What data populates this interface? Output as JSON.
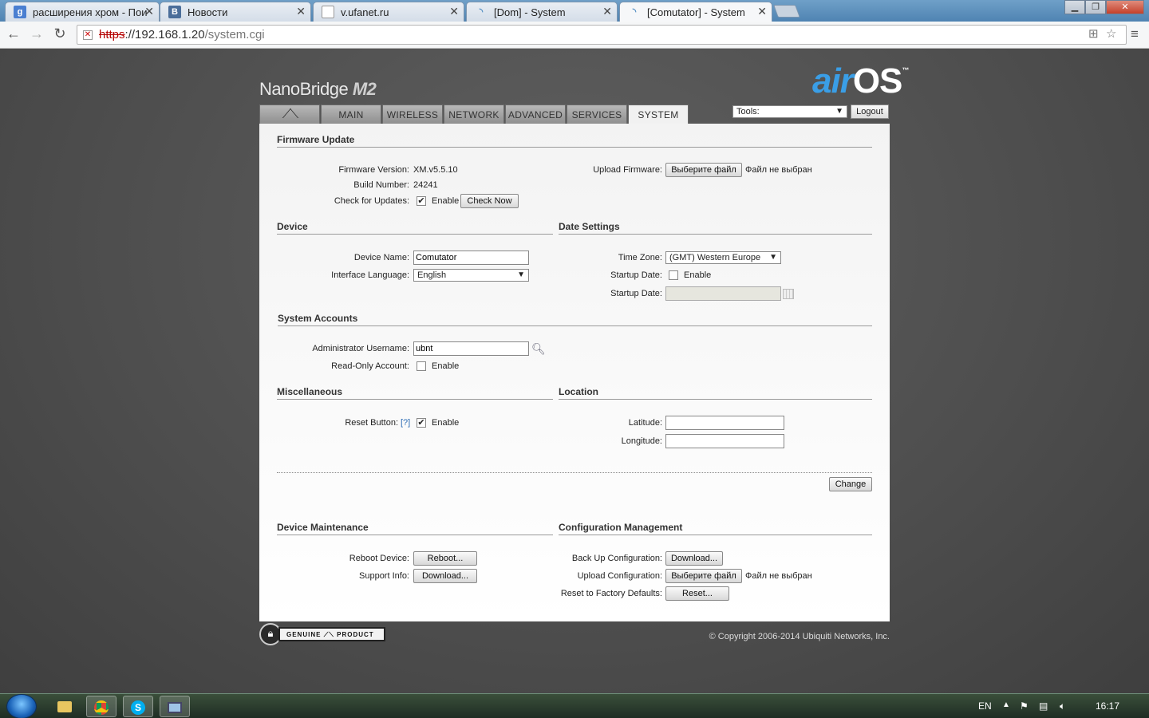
{
  "browser": {
    "tabs": [
      {
        "title": "расширения хром - Пои",
        "icon": "google-icon",
        "active": false
      },
      {
        "title": "Новости",
        "icon": "vk-icon",
        "active": false
      },
      {
        "title": "v.ufanet.ru",
        "icon": "page-icon",
        "active": false
      },
      {
        "title": "[Dom] - System",
        "icon": "wireless-icon",
        "active": false
      },
      {
        "title": "[Comutator] - System",
        "icon": "wireless-icon",
        "active": true
      }
    ],
    "address": {
      "scheme": "https",
      "host_rest": "://192.168.1.20",
      "path": "/system.cgi"
    },
    "window_buttons": {
      "minimize": "▁",
      "maximize": "❐",
      "close": "✕"
    },
    "nav": {
      "back": "←",
      "forward": "→",
      "reload": "↻",
      "menu": "≡",
      "star": "☆"
    }
  },
  "app": {
    "brand": "NanoBridge",
    "brand_model": "M2",
    "logo_air": "air",
    "logo_os": "OS",
    "logo_tm": "™",
    "nav_tabs": [
      "",
      "MAIN",
      "WIRELESS",
      "NETWORK",
      "ADVANCED",
      "SERVICES",
      "SYSTEM"
    ],
    "active_tab": "SYSTEM",
    "tools_label": "Tools:",
    "logout_label": "Logout"
  },
  "firmware": {
    "section_title": "Firmware Update",
    "version_label": "Firmware Version:",
    "version_value": "XM.v5.5.10",
    "build_label": "Build Number:",
    "build_value": "24241",
    "check_label": "Check for Updates:",
    "check_enable": "Enable",
    "check_enabled": true,
    "check_now": "Check Now",
    "upload_label": "Upload Firmware:",
    "choose_file": "Выберите файл",
    "no_file": "Файл не выбран"
  },
  "device": {
    "section_title": "Device",
    "name_label": "Device Name:",
    "name_value": "Comutator",
    "lang_label": "Interface Language:",
    "lang_value": "English"
  },
  "date": {
    "section_title": "Date Settings",
    "tz_label": "Time Zone:",
    "tz_value": "(GMT) Western Europe",
    "startup_enable_label": "Startup Date:",
    "startup_enable": "Enable",
    "startup_date_label": "Startup Date:",
    "startup_date_value": ""
  },
  "accounts": {
    "section_title": "System Accounts",
    "admin_label": "Administrator Username:",
    "admin_value": "ubnt",
    "readonly_label": "Read-Only Account:",
    "readonly_enable": "Enable"
  },
  "misc": {
    "section_title": "Miscellaneous",
    "reset_label": "Reset Button:",
    "reset_help": "[?]",
    "reset_enable": "Enable",
    "reset_enabled": true
  },
  "location": {
    "section_title": "Location",
    "lat_label": "Latitude:",
    "lat_value": "",
    "lon_label": "Longitude:",
    "lon_value": ""
  },
  "change_label": "Change",
  "maintenance": {
    "section_title": "Device Maintenance",
    "reboot_label": "Reboot Device:",
    "reboot_btn": "Reboot...",
    "support_label": "Support Info:",
    "support_btn": "Download..."
  },
  "config": {
    "section_title": "Configuration Management",
    "backup_label": "Back Up Configuration:",
    "backup_btn": "Download...",
    "upload_label": "Upload Configuration:",
    "choose_file": "Выберите файл",
    "no_file": "Файл не выбран",
    "reset_label": "Reset to Factory Defaults:",
    "reset_btn": "Reset..."
  },
  "footer": {
    "genuine": "GENUINE",
    "product": "PRODUCT",
    "copyright": "© Copyright 2006-2014 Ubiquiti Networks, Inc."
  },
  "taskbar": {
    "lang": "EN",
    "time": "16:17"
  }
}
